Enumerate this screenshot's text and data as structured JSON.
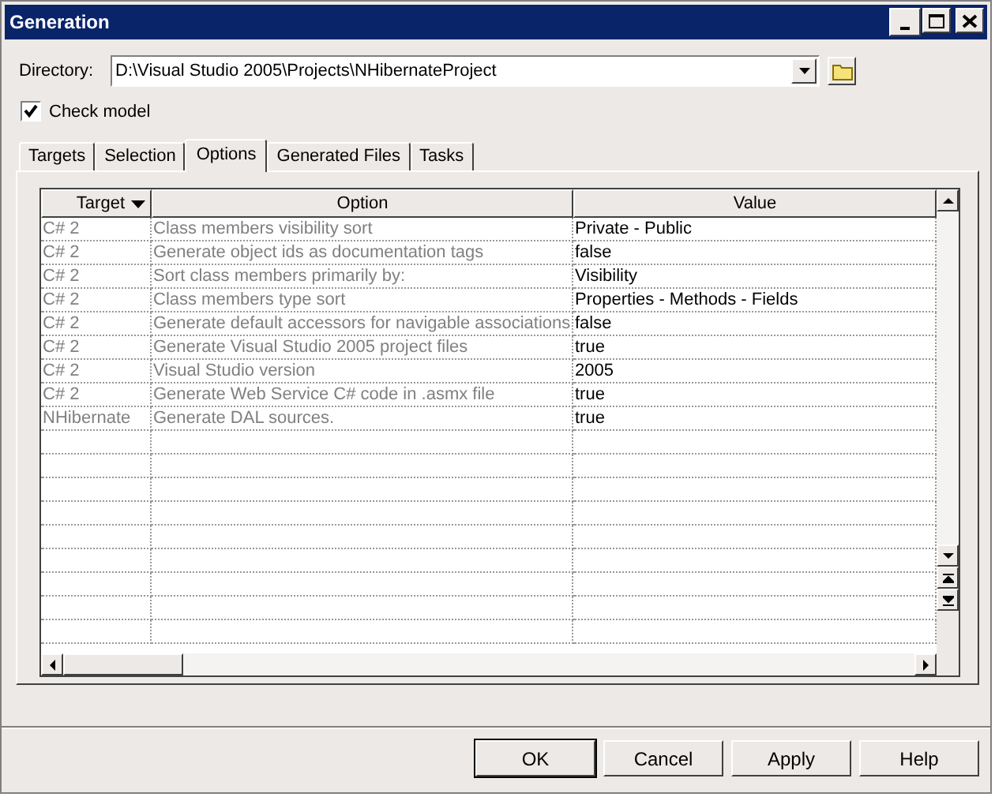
{
  "window": {
    "title": "Generation"
  },
  "directory": {
    "label": "Directory:",
    "value": "D:\\Visual Studio 2005\\Projects\\NHibernateProject"
  },
  "check_model": {
    "label": "Check model",
    "checked": true
  },
  "tabs": [
    {
      "label": "Targets",
      "selected": false
    },
    {
      "label": "Selection",
      "selected": false
    },
    {
      "label": "Options",
      "selected": true
    },
    {
      "label": "Generated Files",
      "selected": false
    },
    {
      "label": "Tasks",
      "selected": false
    }
  ],
  "table": {
    "columns": [
      "Target",
      "Option",
      "Value"
    ],
    "rows": [
      [
        "C# 2",
        "Class members visibility sort",
        "Private - Public"
      ],
      [
        "C# 2",
        "Generate object ids as documentation tags",
        "false"
      ],
      [
        "C# 2",
        "Sort class members primarily by:",
        "Visibility"
      ],
      [
        "C# 2",
        "Class members type sort",
        "Properties - Methods - Fields"
      ],
      [
        "C# 2",
        "Generate default accessors for navigable associations",
        "false"
      ],
      [
        "C# 2",
        "Generate Visual Studio 2005 project files",
        "true"
      ],
      [
        "C# 2",
        "Visual Studio version",
        "2005"
      ],
      [
        "C# 2",
        "Generate Web Service C# code in .asmx file",
        "true"
      ],
      [
        "NHibernate",
        "Generate DAL sources.",
        "true"
      ]
    ]
  },
  "buttons": [
    "OK",
    "Cancel",
    "Apply",
    "Help"
  ]
}
